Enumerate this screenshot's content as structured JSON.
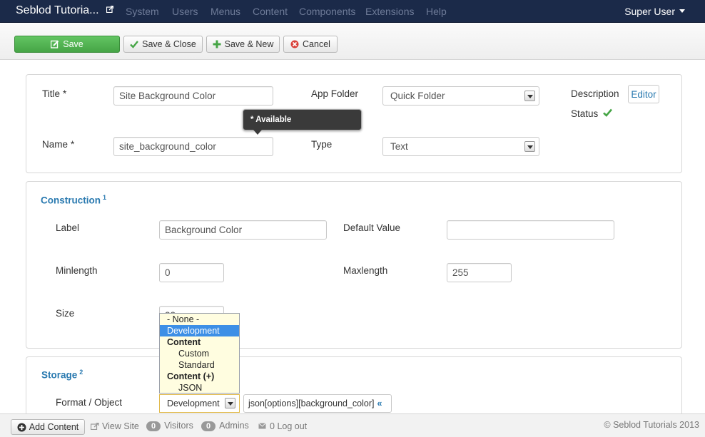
{
  "navbar": {
    "brand": "Seblod Tutoria...",
    "menu": [
      "System",
      "Users",
      "Menus",
      "Content",
      "Components",
      "Extensions",
      "Help"
    ],
    "user": "Super User"
  },
  "toolbar": {
    "save": "Save",
    "save_close": "Save & Close",
    "save_new": "Save & New",
    "cancel": "Cancel"
  },
  "header_panel": {
    "title_label": "Title",
    "title_value": "Site Background Color",
    "name_label": "Name",
    "name_value": "site_background_color",
    "required_mark": "*",
    "tooltip": "* Available",
    "app_folder_label": "App Folder",
    "app_folder_value": "Quick Folder",
    "type_label": "Type",
    "type_value": "Text",
    "description_label": "Description",
    "editor_button": "Editor",
    "status_label": "Status"
  },
  "construction": {
    "title": "Construction",
    "sup": "1",
    "label_label": "Label",
    "label_value": "Background Color",
    "default_label": "Default Value",
    "default_value": "",
    "minlength_label": "Minlength",
    "minlength_value": "0",
    "maxlength_label": "Maxlength",
    "maxlength_value": "255",
    "size_label": "Size",
    "size_value": "32"
  },
  "storage": {
    "title": "Storage",
    "sup": "2",
    "format_label": "Format / Object",
    "format_value": "Development",
    "dropdown_options": [
      {
        "label": "- None -",
        "kind": "option"
      },
      {
        "label": "Development",
        "kind": "selected"
      },
      {
        "label": "Content",
        "kind": "group"
      },
      {
        "label": "Custom",
        "kind": "sub"
      },
      {
        "label": "Standard",
        "kind": "sub"
      },
      {
        "label": "Content (+)",
        "kind": "group"
      },
      {
        "label": "JSON",
        "kind": "sub"
      }
    ],
    "json_value": "json[options][background_color]",
    "json_suffix": "«"
  },
  "statusbar": {
    "add_content": "Add Content",
    "view_site": "View Site",
    "visitors_count": "0",
    "visitors": "Visitors",
    "admins_count": "0",
    "admins": "Admins",
    "logout_count": "0",
    "logout": "Log out",
    "copyright": "© Seblod Tutorials 2013"
  },
  "colors": {
    "navbar": "#1b2a49",
    "accent": "#2a7ab0",
    "save_green": "#46a546",
    "status_check": "#46a546",
    "dropdown_bg": "#fffde0",
    "dropdown_selected": "#3d8fe6"
  }
}
